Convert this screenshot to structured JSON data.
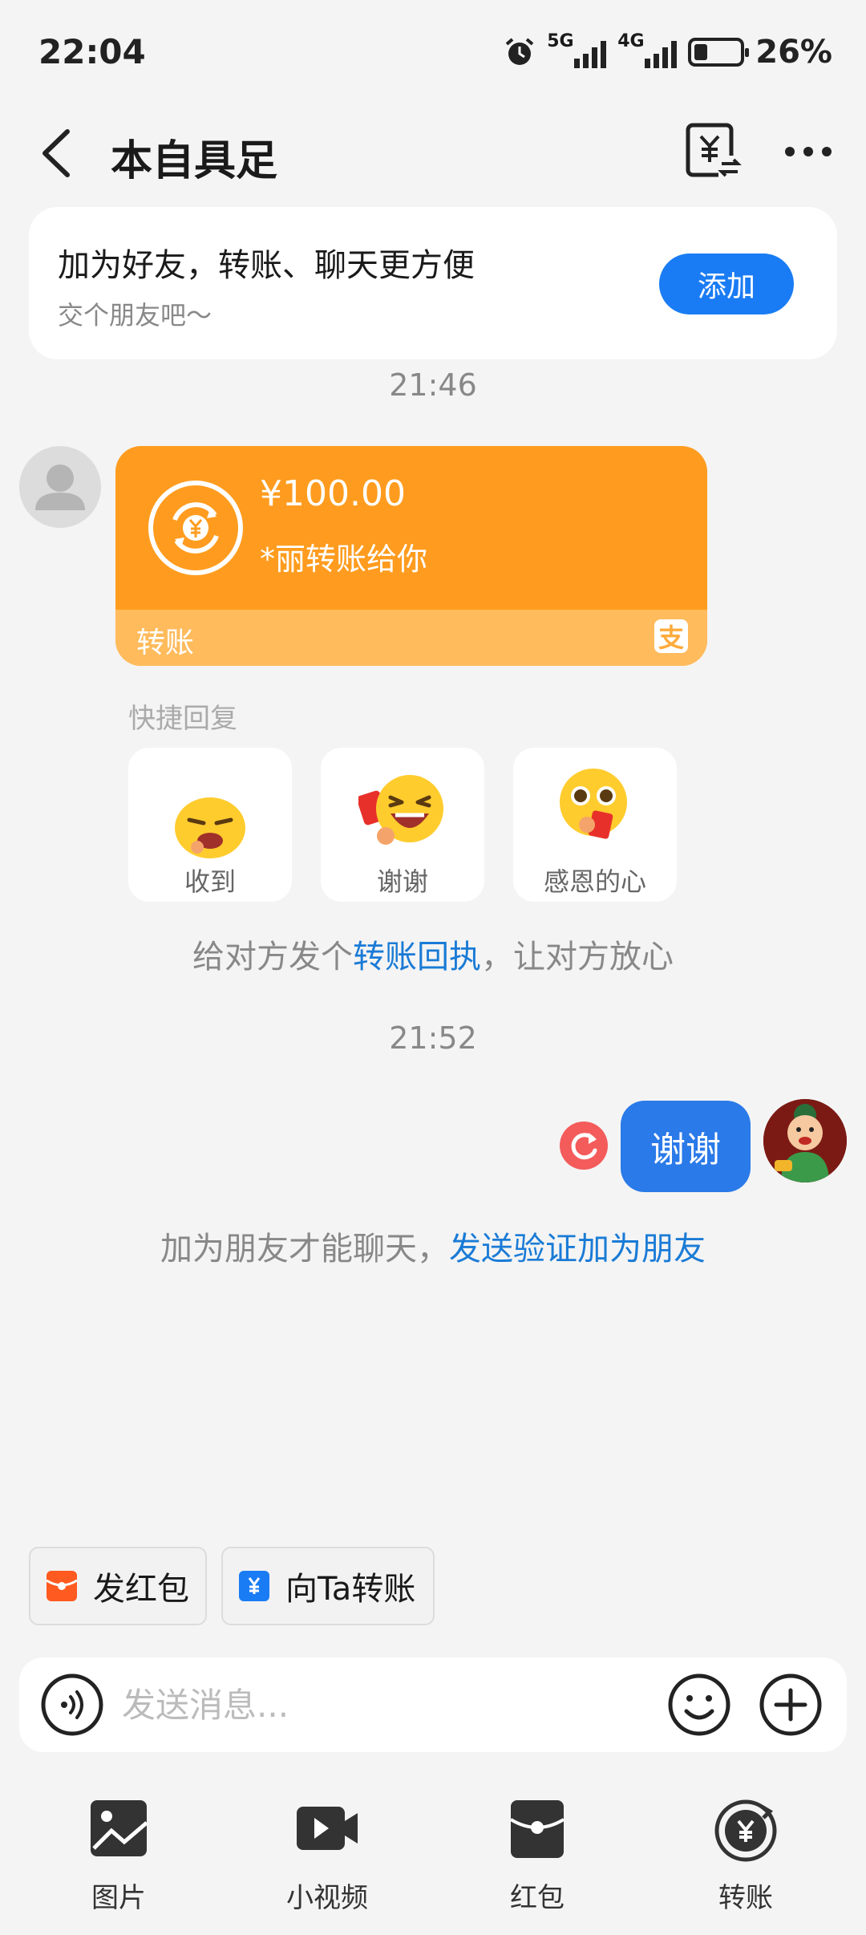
{
  "status": {
    "time": "22:04",
    "signal1": "5G",
    "signal2": "4G",
    "battery": "26%",
    "battery_level": 0.26
  },
  "header": {
    "title": "本自具足"
  },
  "friend_banner": {
    "title": "加为好友，转账、聊天更方便",
    "subtitle": "交个朋友吧～",
    "add_label": "添加"
  },
  "messages": {
    "time1": "21:46",
    "transfer": {
      "amount": "¥100.00",
      "desc": "*丽转账给你",
      "label": "转账",
      "alipay_icon": "支"
    },
    "quick_reply": {
      "label": "快捷回复",
      "items": [
        {
          "label": "收到",
          "icon": "yawning-emoji-icon"
        },
        {
          "label": "谢谢",
          "icon": "laughing-emoji-icon"
        },
        {
          "label": "感恩的心",
          "icon": "grateful-emoji-icon"
        }
      ]
    },
    "receipt_tip": {
      "prefix": "给对方发个",
      "link": "转账回执",
      "suffix": "，让对方放心"
    },
    "time2": "21:52",
    "outgoing": {
      "text": "谢谢",
      "status_icon": "resend-icon"
    },
    "verify_tip": {
      "prefix": "加为朋友才能聊天，",
      "link": "发送验证加为朋友"
    }
  },
  "quick_actions": [
    {
      "label": "发红包",
      "icon": "red-packet-icon",
      "color": "#ff5a1f"
    },
    {
      "label": "向Ta转账",
      "icon": "transfer-icon",
      "color": "#1a7cf4"
    }
  ],
  "input": {
    "placeholder": "发送消息..."
  },
  "toolbar": [
    {
      "label": "图片",
      "icon": "image-icon"
    },
    {
      "label": "小视频",
      "icon": "video-icon"
    },
    {
      "label": "红包",
      "icon": "red-packet-icon"
    },
    {
      "label": "转账",
      "icon": "transfer-icon"
    }
  ],
  "colors": {
    "accent": "#1a7cf4",
    "transfer_orange": "#ff9c1f",
    "bubble_blue": "#2a7ae9",
    "link": "#1a7bd6"
  }
}
